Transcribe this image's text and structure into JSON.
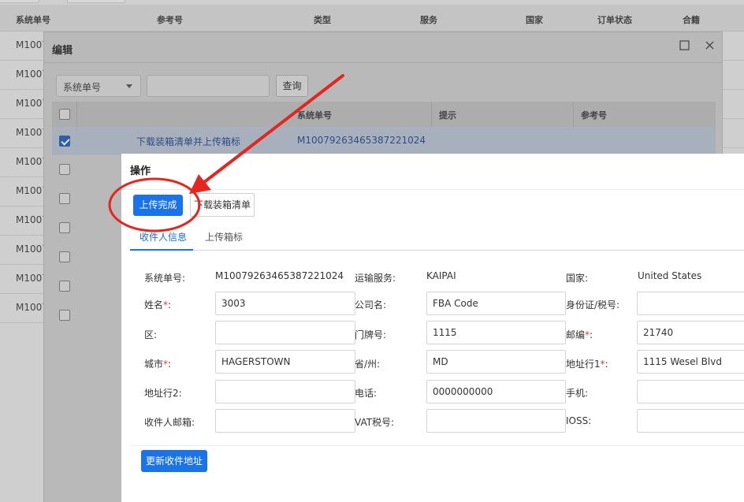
{
  "background_table": {
    "columns": [
      "系统单号",
      "参考号",
      "类型",
      "服务",
      "国家",
      "订单状态",
      "合籍"
    ],
    "row_prefix": [
      "M1007",
      "M1007",
      "M1007",
      "M1007",
      "M1007",
      "M1007",
      "M1007",
      "M1007",
      "M1007",
      "M1007"
    ]
  },
  "edit_dialog": {
    "title": "编辑",
    "filter_select": "系统单号",
    "query_button": "查询",
    "columns": [
      "系统单号",
      "提示",
      "参考号"
    ],
    "row1": {
      "action_link": "下载装箱清单并上传箱标",
      "system_no": "M10079263465387221024"
    }
  },
  "operation_dialog": {
    "title": "操作",
    "upload_done_button": "上传完成",
    "download_list_button": "下载装箱清单",
    "tabs": [
      "收件人信息",
      "上传箱标"
    ],
    "active_tab": 0,
    "fields": {
      "system_no_label": "系统单号:",
      "system_no_value": "M10079263465387221024",
      "shipping_service_label": "运输服务:",
      "shipping_service_value": "KAIPAI",
      "country_label": "国家:",
      "country_value": "United States",
      "name_label": "姓名",
      "name_value": "3003",
      "company_label": "公司名:",
      "company_value": "FBA Code",
      "id_tax_label": "身份证/税号:",
      "id_tax_value": "",
      "district_label": "区:",
      "district_value": "",
      "house_no_label": "门牌号:",
      "house_no_value": "1115",
      "postcode_label": "邮编",
      "postcode_value": "21740",
      "city_label": "城市",
      "city_value": "HAGERSTOWN",
      "province_label": "省/州:",
      "province_value": "MD",
      "address1_label": "地址行1",
      "address1_value": "1115 Wesel Blvd",
      "address2_label": "地址行2:",
      "address2_value": "",
      "phone_label": "电话:",
      "phone_value": "0000000000",
      "mobile_label": "手机:",
      "mobile_value": "",
      "email_label": "收件人邮箱:",
      "email_value": "",
      "vat_label": "VAT税号:",
      "vat_value": "",
      "ioss_label": "IOSS:",
      "ioss_value": ""
    },
    "required_mark": "*",
    "required_suffix": ":",
    "update_address_button": "更新收件地址"
  },
  "colors": {
    "primary": "#1a73e8",
    "annotation_red": "#e5261f",
    "required": "#e03a3a"
  }
}
